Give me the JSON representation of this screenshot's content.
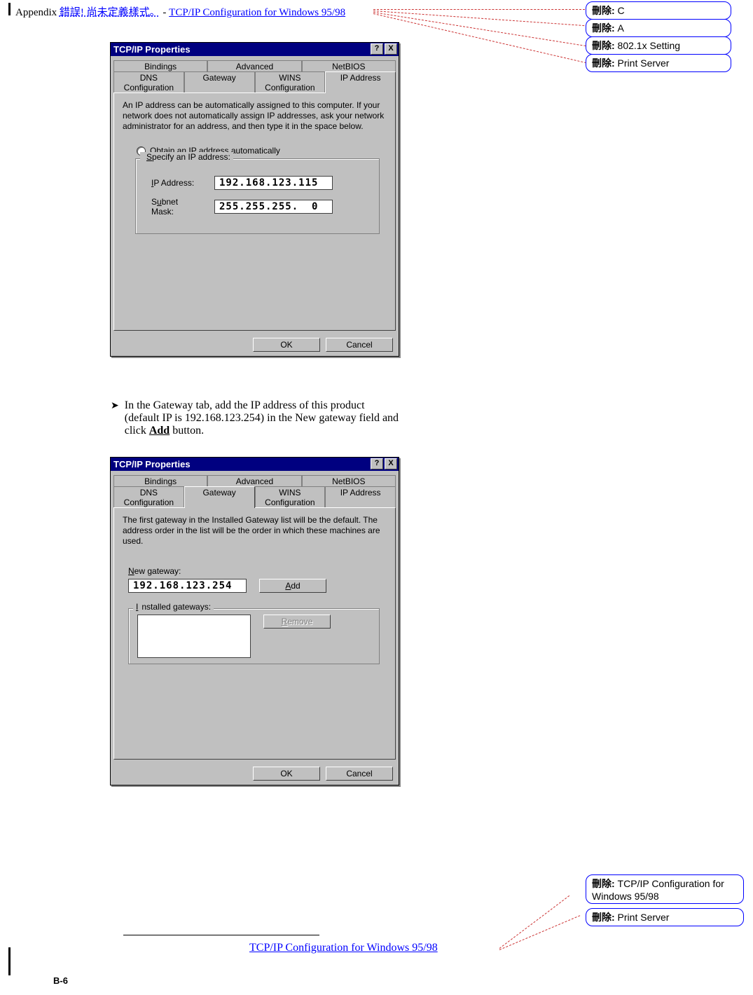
{
  "header": {
    "prefix": "Appendix ",
    "error": "錯誤! 尚未定義樣式。",
    "sep": " - ",
    "link": "TCP/IP Configuration for Windows 95/98"
  },
  "callouts_top": [
    {
      "label": "刪除:",
      "value": " C"
    },
    {
      "label": "刪除:",
      "value": " A"
    },
    {
      "label": "刪除:",
      "value": " 802.1x Setting"
    },
    {
      "label": "刪除:",
      "value": " Print Server"
    }
  ],
  "callouts_bottom": [
    {
      "label": "刪除:",
      "value": " TCP/IP Configuration for Windows 95/98"
    },
    {
      "label": "刪除:",
      "value": " Print Server"
    }
  ],
  "step_text": {
    "line1": "In the Gateway tab, add the IP address of this product",
    "line2": "(default IP is 192.168.123.254) in the New gateway field and",
    "line3_prefix": "click ",
    "line3_bold": "Add",
    "line3_suffix": " button."
  },
  "dlg1": {
    "title": "TCP/IP Properties",
    "help": "?",
    "close": "X",
    "tabs_row1": [
      "Bindings",
      "Advanced",
      "NetBIOS"
    ],
    "tabs_row2": [
      "DNS Configuration",
      "Gateway",
      "WINS Configuration",
      "IP Address"
    ],
    "active_tab": "IP Address",
    "desc": "An IP address can be automatically assigned to this computer. If your network does not automatically assign IP addresses, ask your network administrator for an address, and then type it in the space below.",
    "radio_auto_label": "Obtain an IP address automatically",
    "radio_spec_label": "Specify an IP address:",
    "ip_label": "IP Address:",
    "ip_value": "192.168.123.115",
    "mask_label": "Subnet Mask:",
    "mask_value": "255.255.255.  0",
    "ok": "OK",
    "cancel": "Cancel"
  },
  "dlg2": {
    "title": "TCP/IP Properties",
    "help": "?",
    "close": "X",
    "tabs_row1": [
      "Bindings",
      "Advanced",
      "NetBIOS"
    ],
    "tabs_row2": [
      "DNS Configuration",
      "Gateway",
      "WINS Configuration",
      "IP Address"
    ],
    "active_tab": "Gateway",
    "desc": "The first gateway in the Installed Gateway list will be the default. The address order in the list will be the order in which these machines are used.",
    "new_gw_label": "New gateway:",
    "new_gw_value": "192.168.123.254",
    "add": "Add",
    "installed_label": "Installed gateways:",
    "remove": "Remove",
    "ok": "OK",
    "cancel": "Cancel"
  },
  "footer": {
    "link": "TCP/IP Configuration for Windows 95/98",
    "page": "B-6"
  }
}
